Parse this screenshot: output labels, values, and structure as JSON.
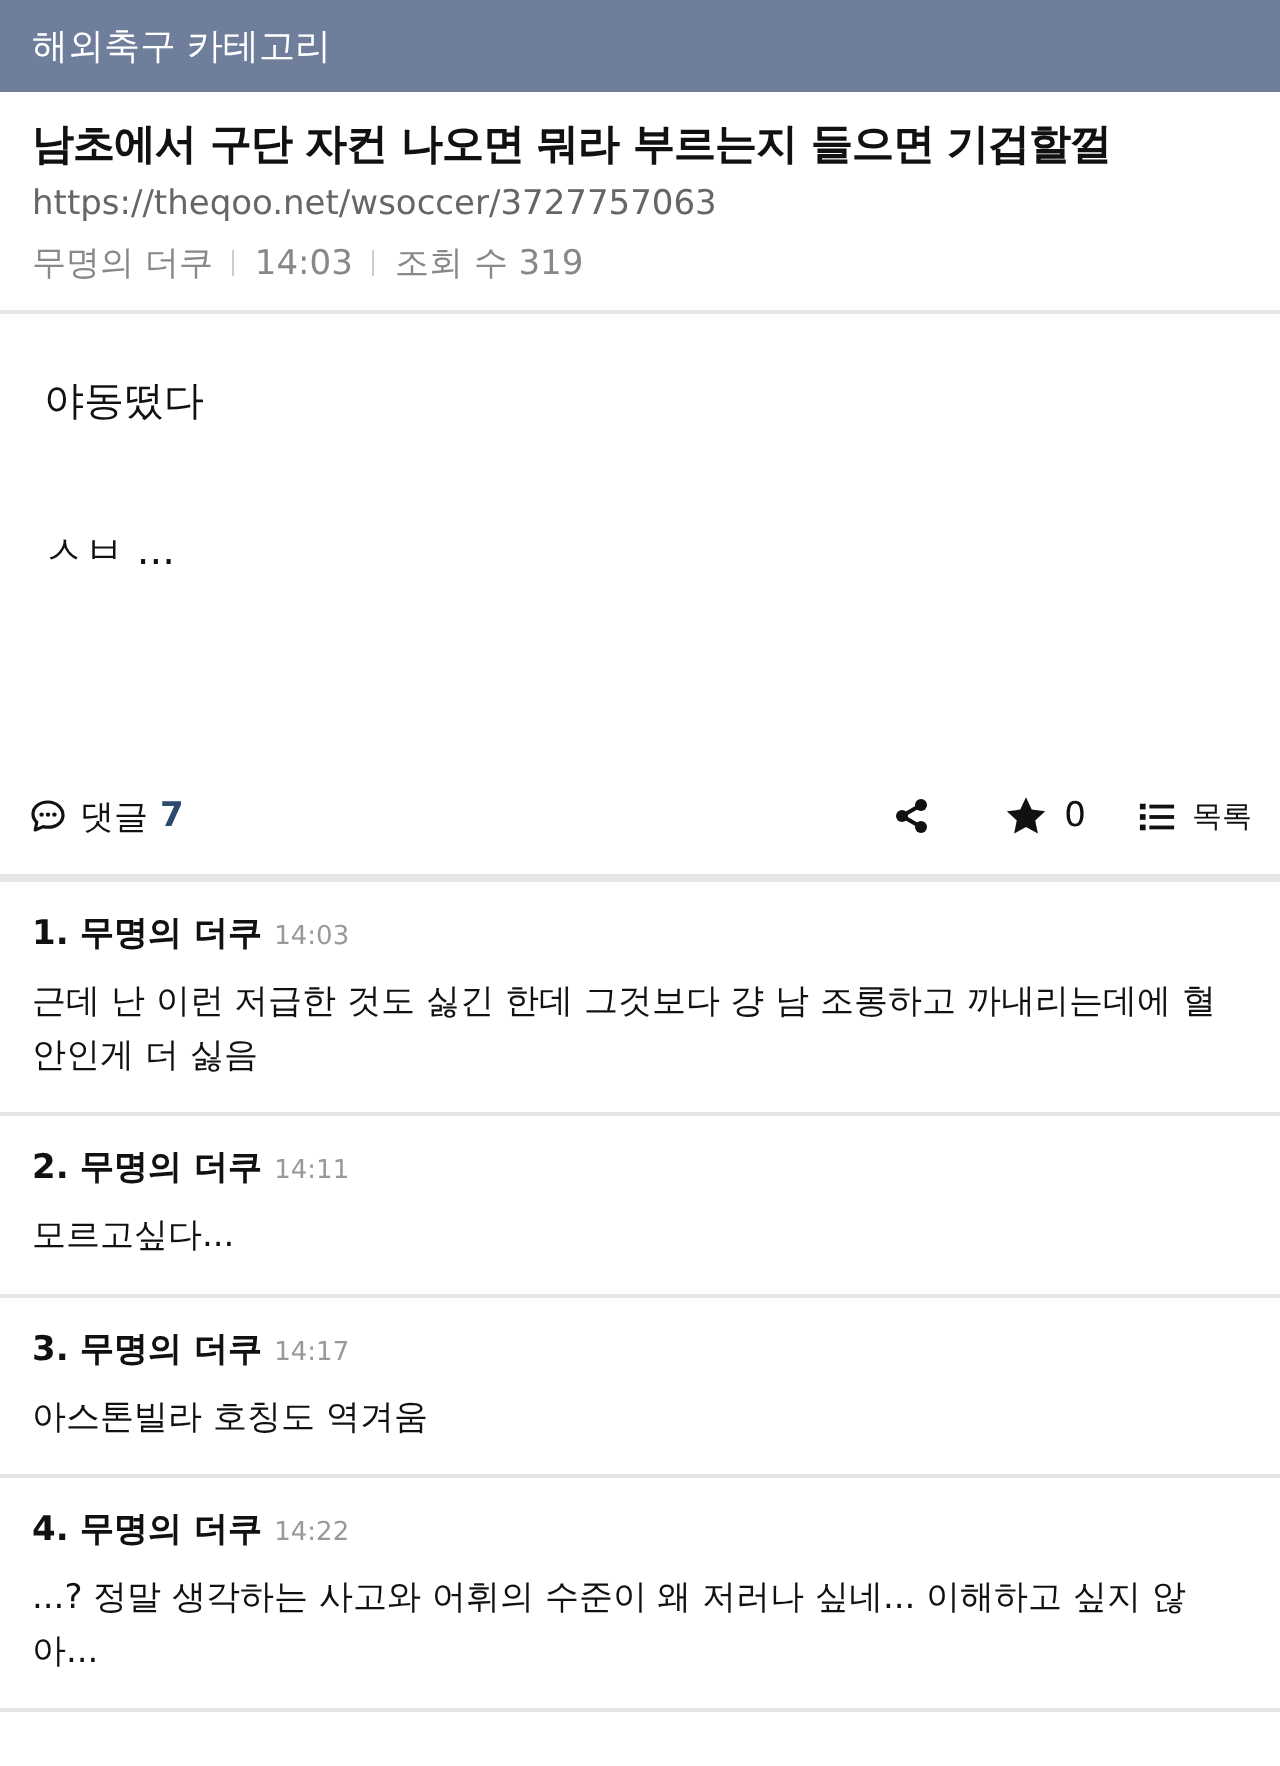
{
  "category": "해외축구 카테고리",
  "post": {
    "title": "남초에서 구단 자컨 나오면 뭐라 부르는지 들으면 기겁할껄",
    "url": "https://theqoo.net/wsoccer/3727757063",
    "author": "무명의 더쿠",
    "time": "14:03",
    "views": "조회 수 319"
  },
  "body": [
    "야동떴다",
    "ㅅㅂ ..."
  ],
  "toolbar": {
    "comments_label": "댓글",
    "comments_count": "7",
    "likes": "0",
    "list_label": "목록"
  },
  "comments": [
    {
      "index": "1.",
      "author": "무명의 더쿠",
      "time": "14:03",
      "text": "근데 난 이런 저급한 것도 싫긴 한데 그것보다 걍 남 조롱하고 까내리는데에 혈안인게 더 싫음"
    },
    {
      "index": "2.",
      "author": "무명의 더쿠",
      "time": "14:11",
      "text": "모르고싶다..."
    },
    {
      "index": "3.",
      "author": "무명의 더쿠",
      "time": "14:17",
      "text": "아스톤빌라 호칭도 역겨움"
    },
    {
      "index": "4.",
      "author": "무명의 더쿠",
      "time": "14:22",
      "text": "...? 정말 생각하는 사고와 어휘의 수준이 왜 저러나 싶네... 이해하고 싶지 않아..."
    }
  ]
}
